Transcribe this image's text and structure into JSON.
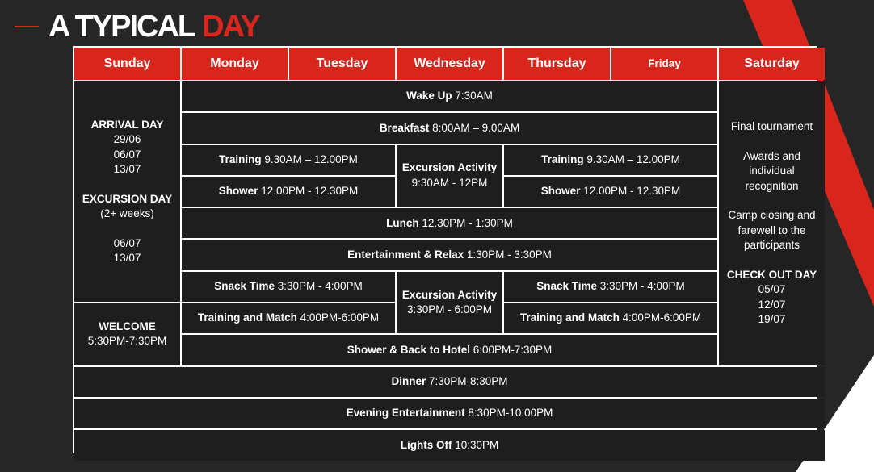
{
  "title": {
    "part1": "A TYPICAL",
    "part2": "DAY"
  },
  "days": [
    "Sunday",
    "Monday",
    "Tuesday",
    "Wednesday",
    "Thursday",
    "Friday",
    "Saturday"
  ],
  "sunday": {
    "arrival_label": "ARRIVAL DAY",
    "arrival_dates": [
      "29/06",
      "06/07",
      "13/07"
    ],
    "excursion_label": "EXCURSION DAY",
    "excursion_note": "(2+ weeks)",
    "excursion_dates": [
      "06/07",
      "13/07"
    ],
    "welcome_label": "WELCOME",
    "welcome_time": "5:30PM-7:30PM"
  },
  "rows": {
    "wakeup": {
      "label": "Wake Up",
      "time": "7:30AM"
    },
    "breakfast": {
      "label": "Breakfast",
      "time": "8:00AM – 9.00AM"
    },
    "training_am_left": {
      "label": "Training",
      "time": "9.30AM – 12.00PM"
    },
    "training_am_right": {
      "label": "Training",
      "time": "9.30AM – 12.00PM"
    },
    "excursion_am": {
      "label": "Excursion Activity",
      "time": "9:30AM - 12PM"
    },
    "shower_left": {
      "label": "Shower",
      "time": "12.00PM - 12.30PM"
    },
    "shower_right": {
      "label": "Shower",
      "time": "12.00PM - 12.30PM"
    },
    "lunch": {
      "label": "Lunch",
      "time": "12.30PM - 1:30PM"
    },
    "entertainment": {
      "label": "Entertainment & Relax",
      "time": "1:30PM - 3:30PM"
    },
    "snack_left": {
      "label": "Snack Time",
      "time": "3:30PM - 4:00PM"
    },
    "snack_right": {
      "label": "Snack Time",
      "time": "3:30PM - 4:00PM"
    },
    "excursion_pm": {
      "label": "Excursion Activity",
      "time": "3:30PM - 6:00PM"
    },
    "match_left": {
      "label": "Training and Match",
      "time": "4:00PM-6:00PM"
    },
    "match_right": {
      "label": "Training and Match",
      "time": "4:00PM-6:00PM"
    },
    "shower_hotel": {
      "label": "Shower & Back to Hotel",
      "time": "6:00PM-7:30PM"
    },
    "dinner": {
      "label": "Dinner",
      "time": "7:30PM-8:30PM"
    },
    "evening": {
      "label": "Evening Entertainment",
      "time": "8:30PM-10:00PM"
    },
    "lights": {
      "label": "Lights Off",
      "time": "10:30PM"
    }
  },
  "saturday": {
    "item1": "Final tournament",
    "item2": "Awards and individual recognition",
    "item3": "Camp closing and farewell to the participants",
    "checkout_label": "CHECK OUT DAY",
    "checkout_dates": [
      "05/07",
      "12/07",
      "19/07"
    ]
  },
  "colors": {
    "accent": "#d9261c",
    "background": "#262626",
    "cell": "#1e1e1e",
    "text": "#ffffff"
  }
}
